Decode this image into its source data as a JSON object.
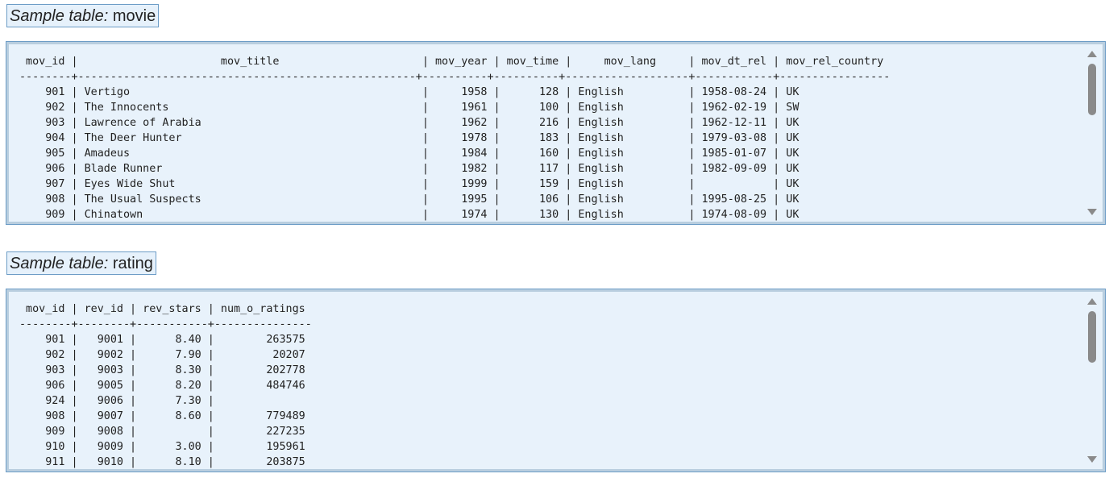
{
  "movie": {
    "caption_prefix": "Sample table:",
    "caption_name": "movie",
    "header": " mov_id |                      mov_title                      | mov_year | mov_time |     mov_lang     | mov_dt_rel | mov_rel_country",
    "separator": "--------+----------------------------------------------------+----------+----------+-------------------+------------+-----------------",
    "rows": [
      "    901 | Vertigo                                             |     1958 |      128 | English          | 1958-08-24 | UK",
      "    902 | The Innocents                                       |     1961 |      100 | English          | 1962-02-19 | SW",
      "    903 | Lawrence of Arabia                                  |     1962 |      216 | English          | 1962-12-11 | UK",
      "    904 | The Deer Hunter                                     |     1978 |      183 | English          | 1979-03-08 | UK",
      "    905 | Amadeus                                             |     1984 |      160 | English          | 1985-01-07 | UK",
      "    906 | Blade Runner                                        |     1982 |      117 | English          | 1982-09-09 | UK",
      "    907 | Eyes Wide Shut                                      |     1999 |      159 | English          |            | UK",
      "    908 | The Usual Suspects                                  |     1995 |      106 | English          | 1995-08-25 | UK",
      "    909 | Chinatown                                           |     1974 |      130 | English          | 1974-08-09 | UK"
    ]
  },
  "rating": {
    "caption_prefix": "Sample table:",
    "caption_name": "rating",
    "header": " mov_id | rev_id | rev_stars | num_o_ratings",
    "separator": "--------+--------+-----------+---------------",
    "rows": [
      "    901 |   9001 |      8.40 |        263575",
      "    902 |   9002 |      7.90 |         20207",
      "    903 |   9003 |      8.30 |        202778",
      "    906 |   9005 |      8.20 |        484746",
      "    924 |   9006 |      7.30 |",
      "    908 |   9007 |      8.60 |        779489",
      "    909 |   9008 |           |        227235",
      "    910 |   9009 |      3.00 |        195961",
      "    911 |   9010 |      8.10 |        203875"
    ]
  },
  "icons": {
    "scroll_up": "triangle-up",
    "scroll_down": "triangle-down"
  },
  "colors": {
    "panel_bg": "#e8f2fb",
    "panel_border": "#6c9cc6",
    "scrollbar_thumb": "#8a8a8a"
  }
}
